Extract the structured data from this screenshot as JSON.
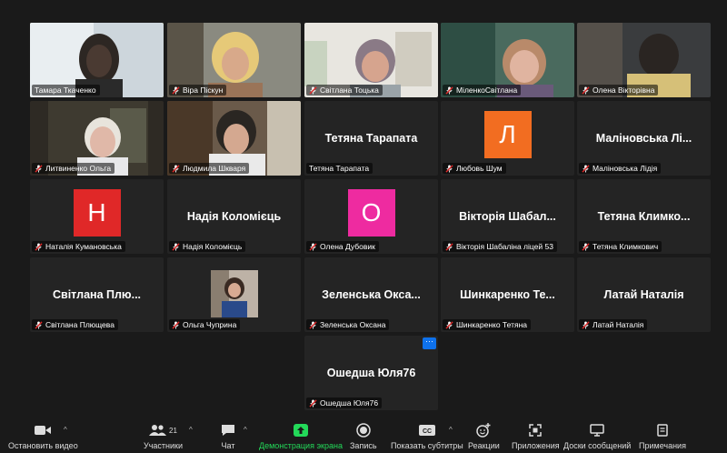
{
  "participants": [
    {
      "name": "Тамара Ткаченко",
      "type": "video",
      "scene": "s1",
      "active": true,
      "muted": false
    },
    {
      "name": "Віра Піскун",
      "type": "video",
      "scene": "s2",
      "muted": true
    },
    {
      "name": "Світлана Тоцька",
      "type": "video",
      "scene": "s3",
      "muted": true
    },
    {
      "name": "МіленкоСвітлана",
      "type": "video",
      "scene": "s4",
      "muted": true
    },
    {
      "name": "Олена Вікторівна",
      "type": "video",
      "scene": "s5",
      "muted": true
    },
    {
      "name": "Литвиненко Ольга",
      "type": "video",
      "scene": "s6",
      "muted": true
    },
    {
      "name": "Людмила Шкваря",
      "type": "video",
      "scene": "s7",
      "muted": true
    },
    {
      "name": "Тетяна Тарапата",
      "type": "name",
      "display": "Тетяна Тарапата",
      "muted": false
    },
    {
      "name": "Любовь Шум",
      "type": "avatar",
      "letter": "Л",
      "color": "#f26d21",
      "muted": true
    },
    {
      "name": "Маліновська Лідія",
      "type": "name",
      "display": "Маліновська Лі...",
      "muted": true
    },
    {
      "name": "Наталія Кумановська",
      "type": "avatar",
      "letter": "Н",
      "color": "#e02828",
      "muted": true
    },
    {
      "name": "Надія Коломієць",
      "type": "name",
      "display": "Надія Коломієць",
      "muted": true
    },
    {
      "name": "Олена Дубовик",
      "type": "avatar",
      "letter": "О",
      "color": "#ee2ba0",
      "muted": true
    },
    {
      "name": "Вікторія Шабаліна ліцей 53",
      "type": "name",
      "display": "Вікторія Шабал...",
      "muted": true
    },
    {
      "name": "Тетяна Климкович",
      "type": "name",
      "display": "Тетяна Климко...",
      "muted": true
    },
    {
      "name": "Світлана Плющева",
      "type": "name",
      "display": "Світлана Плю...",
      "muted": true
    },
    {
      "name": "Ольга Чуприна",
      "type": "photo",
      "muted": true
    },
    {
      "name": "Зеленська Оксана",
      "type": "name",
      "display": "Зеленська Окса...",
      "muted": true
    },
    {
      "name": "Шинкаренко Тетяна",
      "type": "name",
      "display": "Шинкаренко Те...",
      "muted": true
    },
    {
      "name": "Латай Наталія",
      "type": "name",
      "display": "Латай Наталія",
      "muted": true
    },
    {
      "name": "Ошедша Юля76",
      "type": "name",
      "display": "Ошедша Юля76",
      "muted": true,
      "more": true
    }
  ],
  "toolbar": {
    "stop_video": "Остановить видео",
    "participants": "Участники",
    "participants_count": "21",
    "chat": "Чат",
    "share": "Демонстрация экрана",
    "record": "Запись",
    "subtitles": "Показать субтитры",
    "reactions": "Реакции",
    "apps": "Приложения",
    "whiteboards": "Доски сообщений",
    "notes": "Примечания",
    "more_label": "···"
  },
  "colors": {
    "accent_green": "#23d959",
    "active_border": "#f1ef66",
    "mute_red": "#e02828",
    "button_blue": "#0e71eb"
  }
}
